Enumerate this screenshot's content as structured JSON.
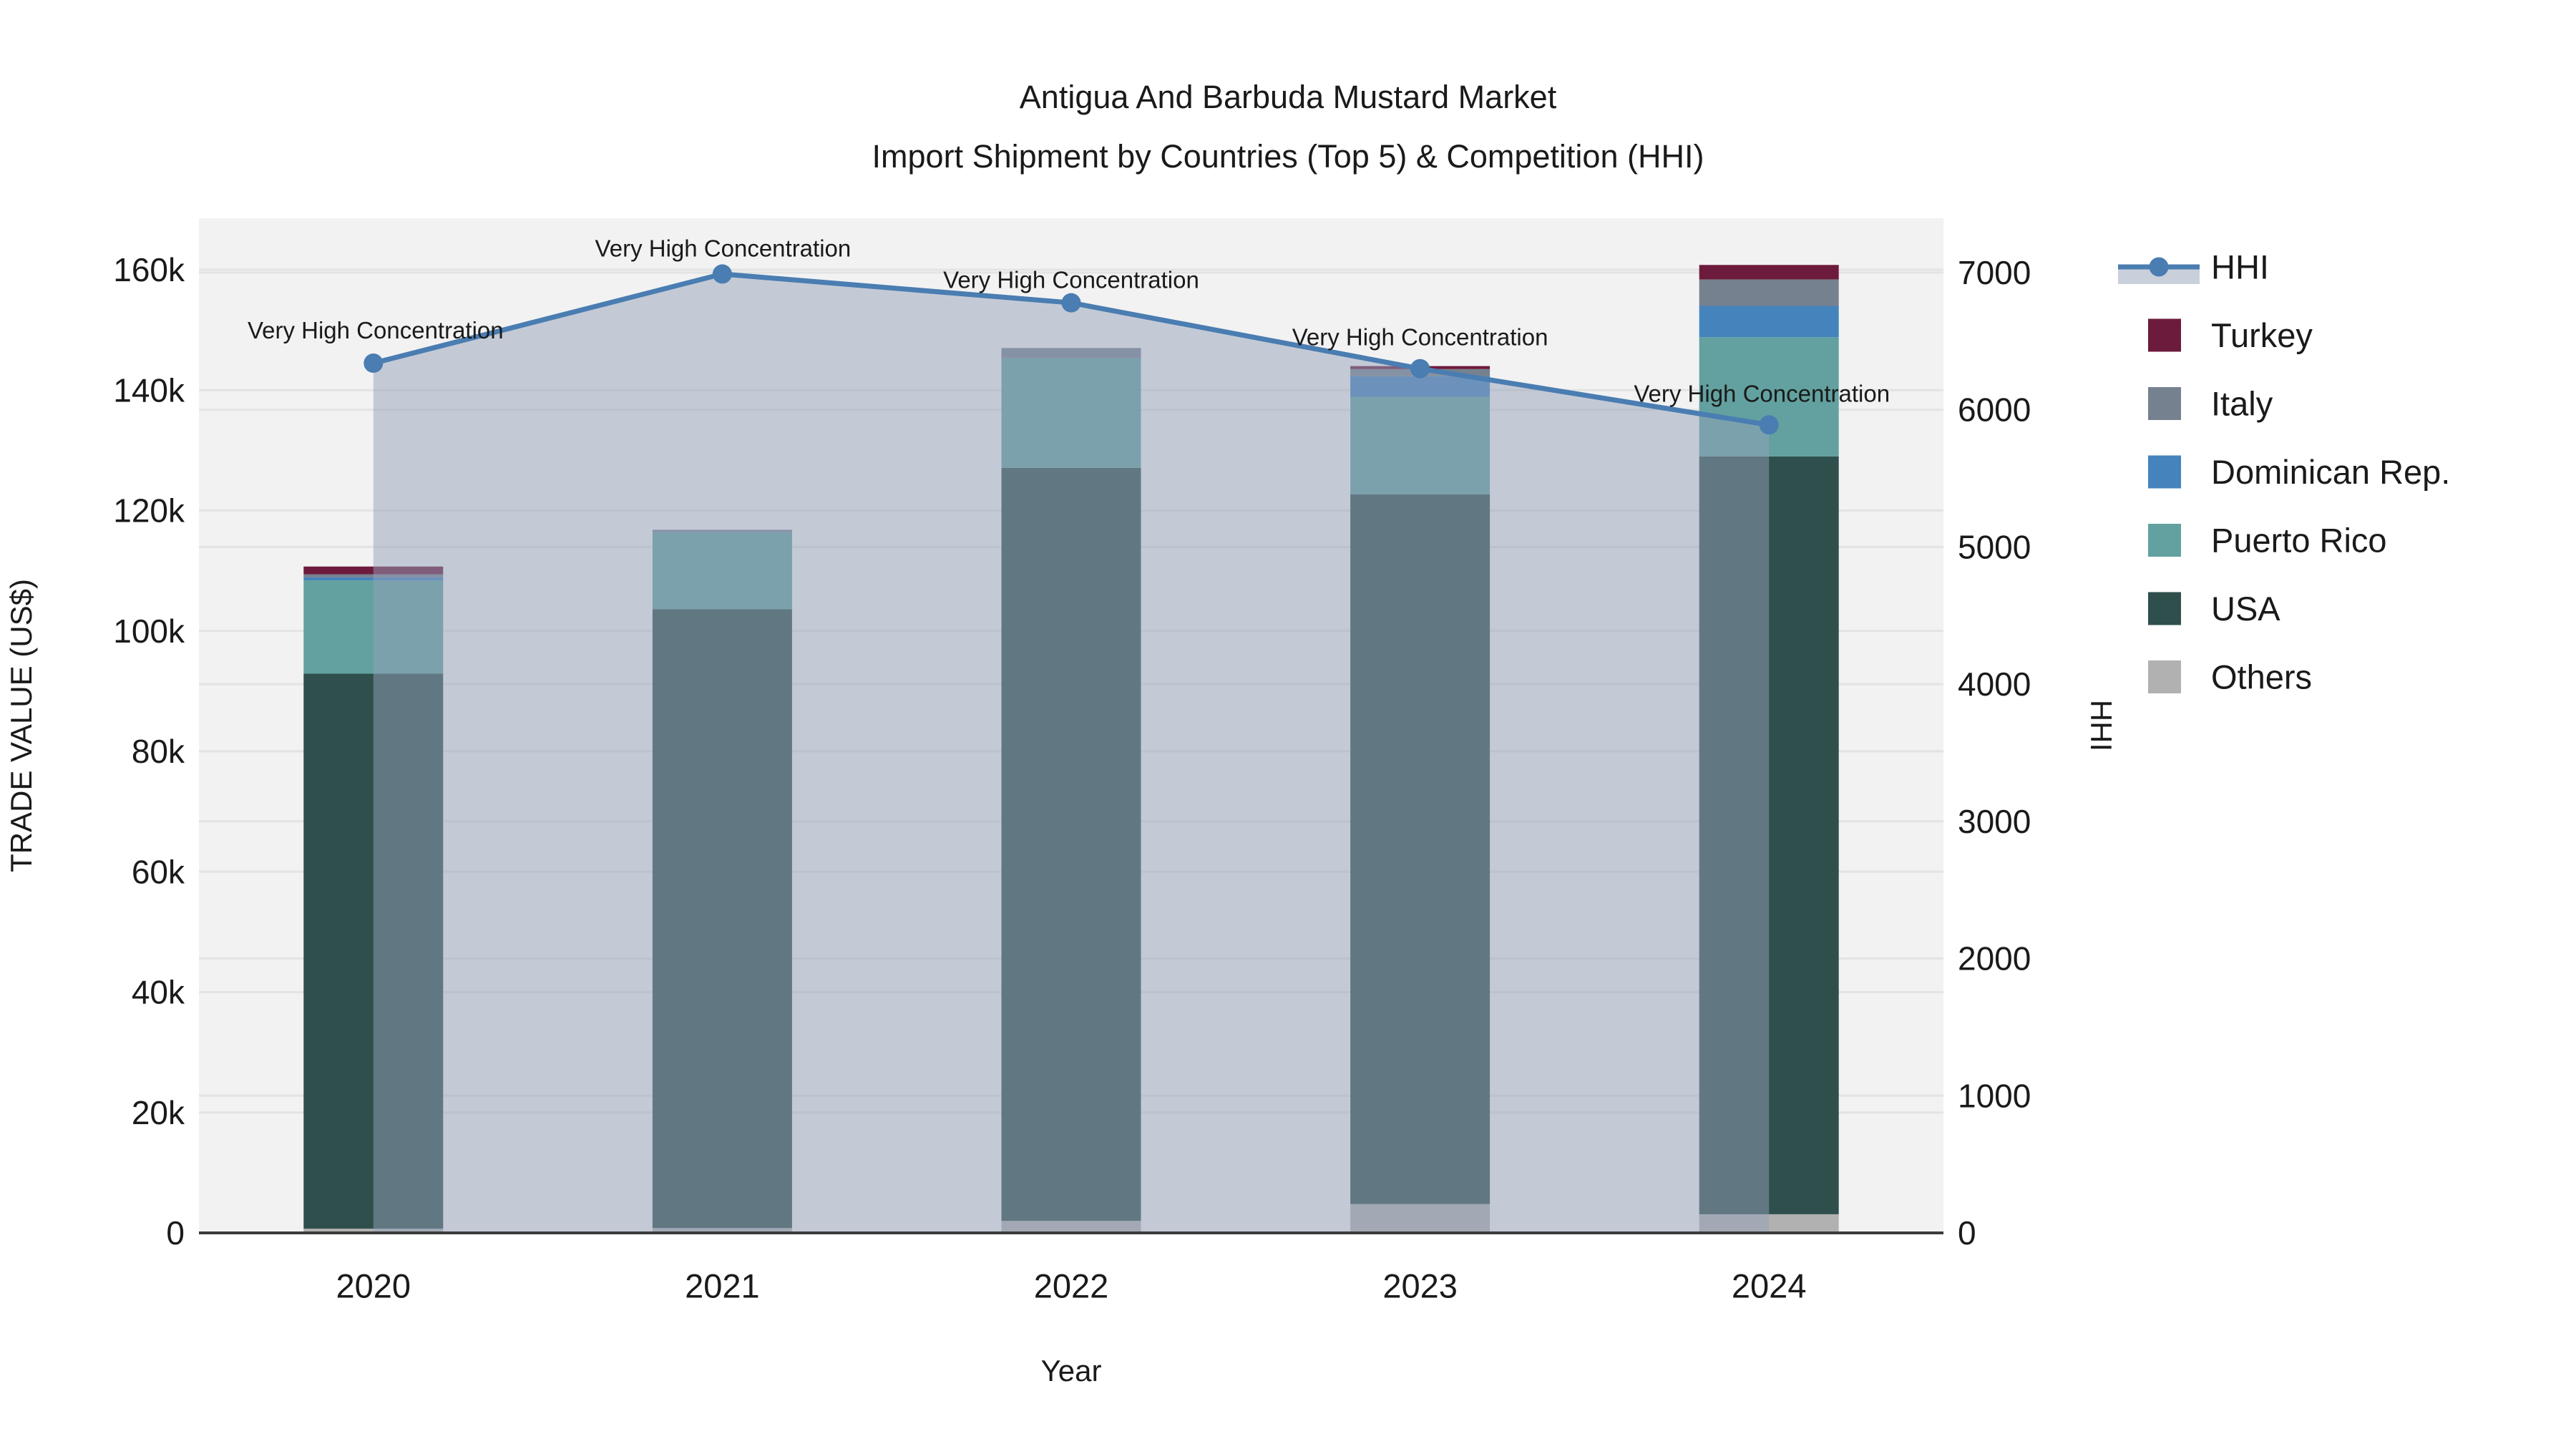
{
  "title": {
    "line1": "Antigua And Barbuda Mustard Market",
    "line2": "Import Shipment by Countries (Top 5) & Competition (HHI)"
  },
  "chart_data": {
    "type": "combo",
    "description": "Stacked bars of import trade value by origin country with HHI concentration line and shaded area on secondary axis",
    "categories": [
      "2020",
      "2021",
      "2022",
      "2023",
      "2024"
    ],
    "stack_order_bottom_to_top": [
      "Others",
      "USA",
      "Puerto Rico",
      "Dominican Rep.",
      "Italy",
      "Turkey"
    ],
    "series": [
      {
        "name": "Others",
        "color": "#b1b1b1",
        "values": [
          700,
          800,
          2000,
          4800,
          3100
        ]
      },
      {
        "name": "USA",
        "color": "#2f4f4d",
        "values": [
          92200,
          102800,
          125100,
          117900,
          125900
        ]
      },
      {
        "name": "Puerto Rico",
        "color": "#62a1a0",
        "values": [
          15500,
          12800,
          18200,
          16200,
          19800
        ]
      },
      {
        "name": "Dominican Rep.",
        "color": "#4583bd",
        "values": [
          500,
          0,
          0,
          3400,
          5200
        ]
      },
      {
        "name": "Italy",
        "color": "#76818f",
        "values": [
          500,
          400,
          1700,
          1200,
          4400
        ]
      },
      {
        "name": "Turkey",
        "color": "#6d1b3c",
        "values": [
          1300,
          0,
          0,
          500,
          2400
        ]
      }
    ],
    "bar_totals": [
      110700,
      116800,
      147000,
      144000,
      160800
    ],
    "hhi_line": {
      "name": "HHI",
      "color": "#4a7db1",
      "area_color": "rgba(147,162,186,0.5)",
      "values": [
        6340,
        6990,
        6780,
        6300,
        5890
      ]
    },
    "annotations": [
      "Very High Concentration",
      "Very High Concentration",
      "Very High Concentration",
      "Very High Concentration",
      "Very High Concentration"
    ],
    "y_left": {
      "title": "TRADE VALUE (US$)",
      "tick_values": [
        0,
        20000,
        40000,
        60000,
        80000,
        100000,
        120000,
        140000,
        160000
      ],
      "tick_labels": [
        "0",
        "20k",
        "40k",
        "60k",
        "80k",
        "100k",
        "120k",
        "140k",
        "160k"
      ],
      "range": [
        0,
        168600
      ]
    },
    "y_right": {
      "title": "HHI",
      "tick_values": [
        0,
        1000,
        2000,
        3000,
        4000,
        5000,
        6000,
        7000
      ],
      "tick_labels": [
        "0",
        "1000",
        "2000",
        "3000",
        "4000",
        "5000",
        "6000",
        "7000"
      ],
      "range": [
        0,
        7430
      ]
    },
    "x_axis": {
      "title": "Year"
    },
    "legend_order": [
      "HHI",
      "Turkey",
      "Italy",
      "Dominican Rep.",
      "Puerto Rico",
      "USA",
      "Others"
    ],
    "style": {
      "plot_bg": "#f2f2f2",
      "grid_color": "#e3e3e3",
      "axis_line_color": "#3b3b3b",
      "text_color": "#1a1a1a"
    }
  }
}
